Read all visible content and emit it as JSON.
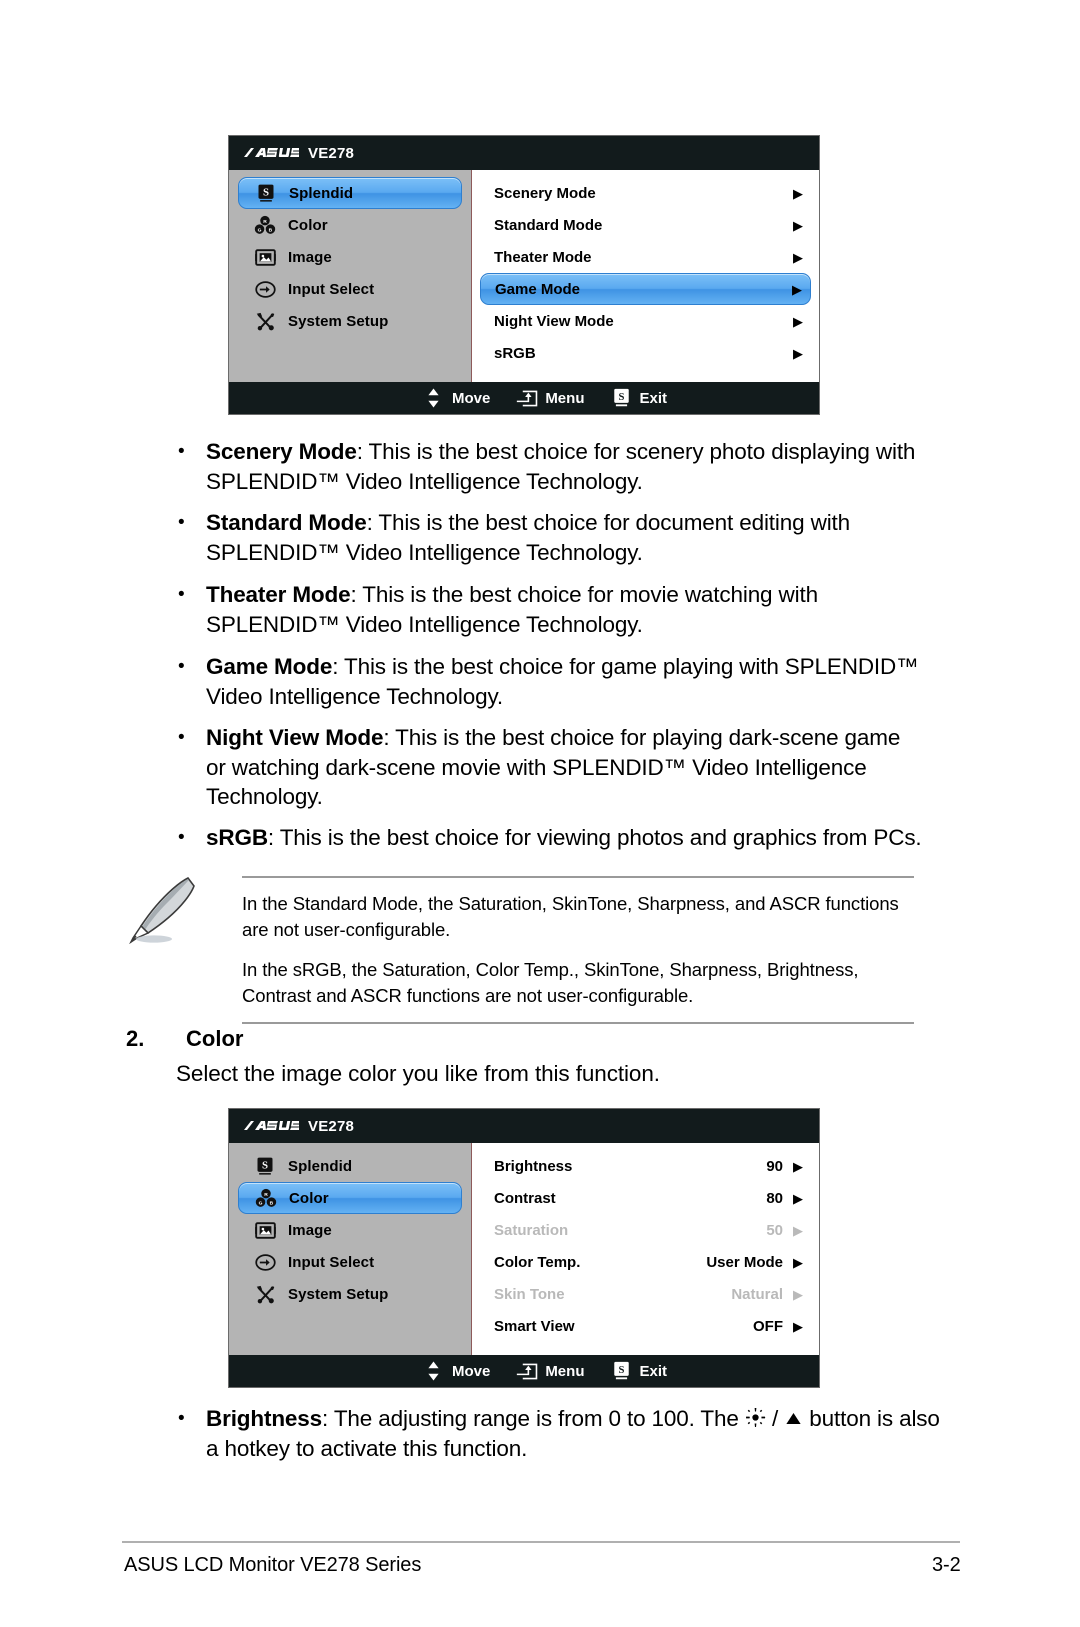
{
  "osd_menus": [
    {
      "id": "splendid-menu",
      "model": "VE278",
      "brand": "ASUS",
      "sidebar": [
        {
          "label": "Splendid",
          "icon": "splendid-icon",
          "selected": true
        },
        {
          "label": "Color",
          "icon": "color-icon",
          "selected": false
        },
        {
          "label": "Image",
          "icon": "image-icon",
          "selected": false
        },
        {
          "label": "Input Select",
          "icon": "input-select-icon",
          "selected": false
        },
        {
          "label": "System Setup",
          "icon": "system-setup-icon",
          "selected": false
        }
      ],
      "items": [
        {
          "label": "Scenery Mode",
          "value": "",
          "selected": false,
          "disabled": false,
          "arrow": "▶"
        },
        {
          "label": "Standard Mode",
          "value": "",
          "selected": false,
          "disabled": false,
          "arrow": "▶"
        },
        {
          "label": "Theater Mode",
          "value": "",
          "selected": false,
          "disabled": false,
          "arrow": "▶"
        },
        {
          "label": "Game Mode",
          "value": "",
          "selected": true,
          "disabled": false,
          "arrow": "▶"
        },
        {
          "label": "Night View Mode",
          "value": "",
          "selected": false,
          "disabled": false,
          "arrow": "▶"
        },
        {
          "label": "sRGB",
          "value": "",
          "selected": false,
          "disabled": false,
          "arrow": "▶"
        }
      ],
      "footer": [
        {
          "label": "Move",
          "icon": "up-down-arrows-icon"
        },
        {
          "label": "Menu",
          "icon": "menu-enter-icon"
        },
        {
          "label": "Exit",
          "icon": "splendid-s-icon"
        }
      ]
    },
    {
      "id": "color-menu",
      "model": "VE278",
      "brand": "ASUS",
      "sidebar": [
        {
          "label": "Splendid",
          "icon": "splendid-icon",
          "selected": false
        },
        {
          "label": "Color",
          "icon": "color-icon",
          "selected": true
        },
        {
          "label": "Image",
          "icon": "image-icon",
          "selected": false
        },
        {
          "label": "Input Select",
          "icon": "input-select-icon",
          "selected": false
        },
        {
          "label": "System Setup",
          "icon": "system-setup-icon",
          "selected": false
        }
      ],
      "items": [
        {
          "label": "Brightness",
          "value": "90",
          "selected": false,
          "disabled": false,
          "arrow": "▶"
        },
        {
          "label": "Contrast",
          "value": "80",
          "selected": false,
          "disabled": false,
          "arrow": "▶"
        },
        {
          "label": "Saturation",
          "value": "50",
          "selected": false,
          "disabled": true,
          "arrow": "▶"
        },
        {
          "label": "Color Temp.",
          "value": "User Mode",
          "selected": false,
          "disabled": false,
          "arrow": "▶"
        },
        {
          "label": "Skin Tone",
          "value": "Natural",
          "selected": false,
          "disabled": true,
          "arrow": "▶"
        },
        {
          "label": "Smart View",
          "value": "OFF",
          "selected": false,
          "disabled": false,
          "arrow": "▶"
        }
      ],
      "footer": [
        {
          "label": "Move",
          "icon": "up-down-arrows-icon"
        },
        {
          "label": "Menu",
          "icon": "menu-enter-icon"
        },
        {
          "label": "Exit",
          "icon": "splendid-s-icon"
        }
      ]
    }
  ],
  "bullets": [
    {
      "marker": "•",
      "bold": "Scenery Mode",
      "rest": ": This is the best choice for scenery photo displaying with SPLENDID™ Video Intelligence Technology."
    },
    {
      "marker": "•",
      "bold": "Standard Mode",
      "rest": ": This is the best choice for document editing with SPLENDID™ Video Intelligence Technology."
    },
    {
      "marker": "•",
      "bold": "Theater Mode",
      "rest": ": This is the best choice for movie watching with SPLENDID™ Video Intelligence Technology."
    },
    {
      "marker": "•",
      "bold": "Game Mode",
      "rest": ": This is the best choice for game playing with SPLENDID™ Video Intelligence Technology."
    },
    {
      "marker": "•",
      "bold": "Night View Mode",
      "rest": ": This is the best choice for playing dark-scene game or watching dark-scene movie with SPLENDID™ Video Intelligence Technology."
    },
    {
      "marker": "•",
      "bold": "sRGB",
      "rest": ": This is the best choice for viewing photos and graphics from PCs."
    }
  ],
  "note": {
    "icon": "quill-pen-icon",
    "paragraphs": [
      "In the Standard Mode, the Saturation, SkinTone, Sharpness, and ASCR functions are not user-configurable.",
      "In the sRGB, the Saturation, Color Temp., SkinTone, Sharpness, Brightness, Contrast and ASCR functions are not user-configurable."
    ]
  },
  "section": {
    "number": "2.",
    "title": "Color",
    "lead": "Select the image color you like from this function."
  },
  "brightness_bullet": {
    "marker": "•",
    "bold": "Brightness",
    "part1": ": The adjusting range is from 0 to 100. The ",
    "sep": " / ",
    "part2": " button is also a hotkey to activate this function."
  },
  "page_footer": {
    "left": "ASUS LCD Monitor VE278 Series",
    "right": "3-2"
  }
}
